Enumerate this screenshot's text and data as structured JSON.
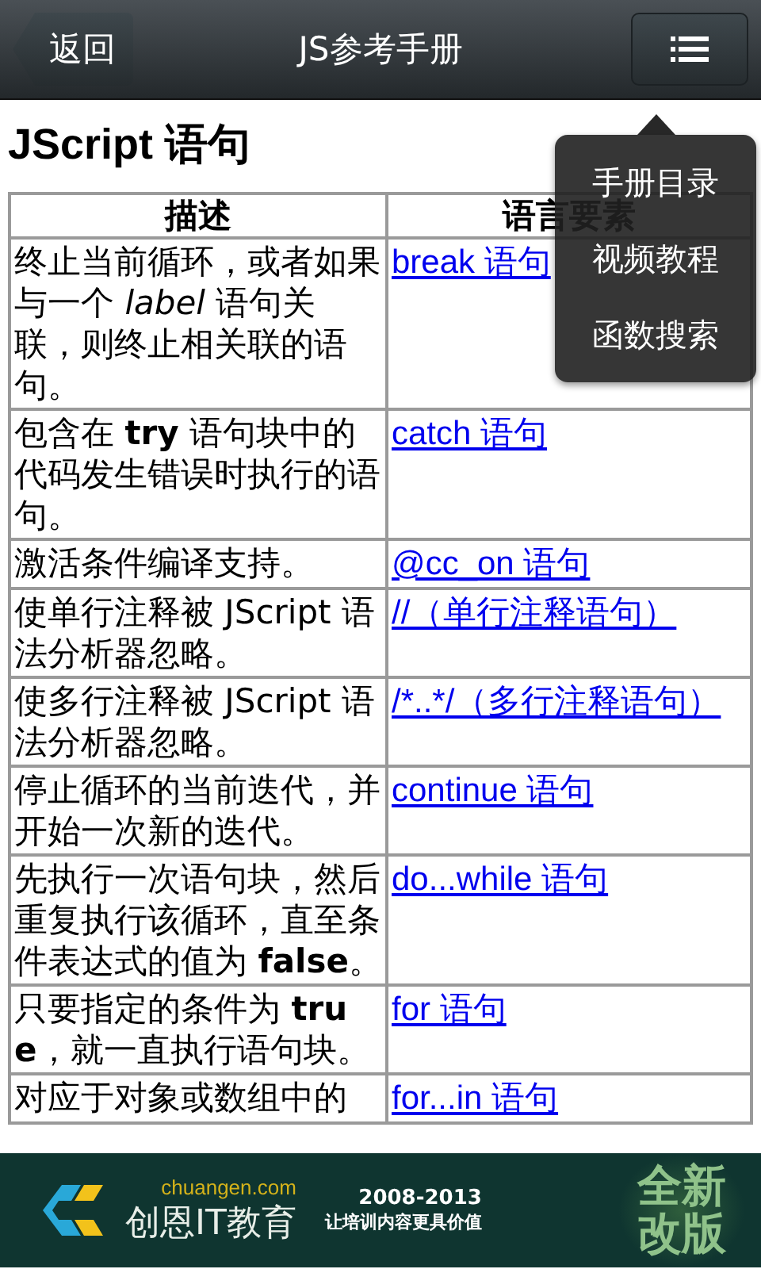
{
  "header": {
    "back": "返回",
    "title": "JS参考手册"
  },
  "page_title": "JScript 语句",
  "table": {
    "columns": [
      "描述",
      "语言要素"
    ],
    "rows": [
      {
        "description": "终止当前循环，或者如果与一个 *label* 语句关联，则终止相关联的语句。",
        "element": "break 语句"
      },
      {
        "description": "包含在 **try** 语句块中的代码发生错误时执行的语句。",
        "element": "catch 语句"
      },
      {
        "description": "激活条件编译支持。",
        "element": "@cc_on 语句"
      },
      {
        "description": "使单行注释被 JScript 语法分析器忽略。",
        "element": "//（单行注释语句）"
      },
      {
        "description": "使多行注释被 JScript 语法分析器忽略。",
        "element": "/*..*/（多行注释语句）"
      },
      {
        "description": "停止循环的当前迭代，并开始一次新的迭代。",
        "element": "continue 语句"
      },
      {
        "description": "先执行一次语句块，然后重复执行该循环，直至条件表达式的值为 **false**。",
        "element": "do...while 语句"
      },
      {
        "description": "只要指定的条件为 **true**，就一直执行语句块。",
        "element": "for 语句"
      },
      {
        "description": "对应于对象或数组中的",
        "element": "for...in 语句"
      }
    ]
  },
  "menu": [
    "手册目录",
    "视频教程",
    "函数搜索"
  ],
  "banner": {
    "site": "chuangen.com",
    "brand": "创恩IT教育",
    "years": "2008-2013",
    "slogan": "让培训内容更具价值",
    "badge": "全新改版"
  }
}
